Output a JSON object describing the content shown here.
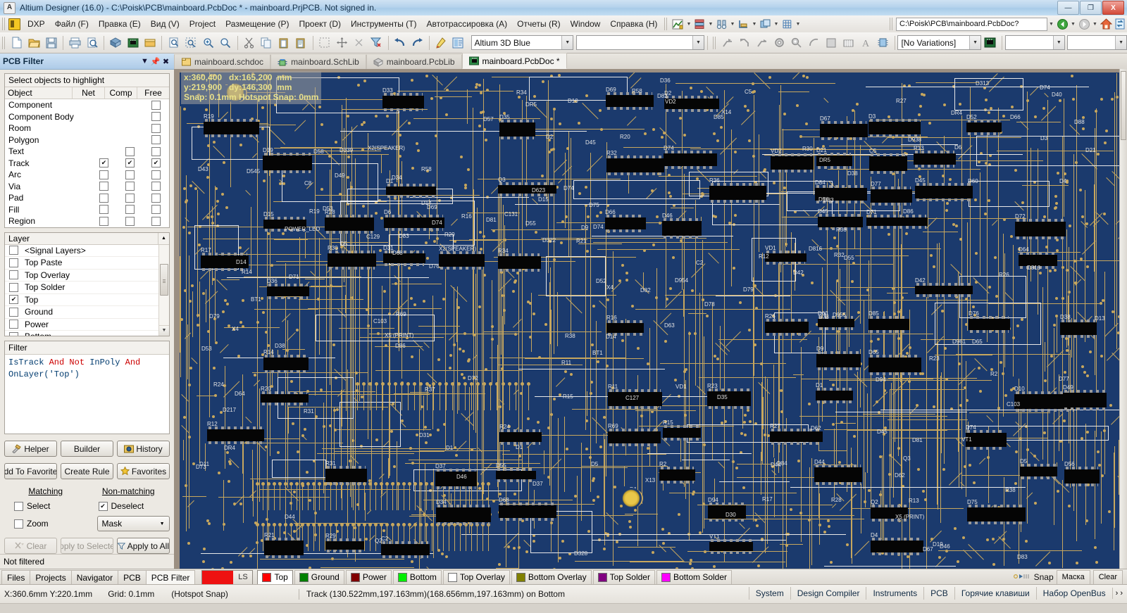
{
  "window": {
    "title": "Altium Designer (16.0) - C:\\Poisk\\PCB\\mainboard.PcbDoc * - mainboard.PrjPCB. Not signed in.",
    "app_icon": "A",
    "minimize": "—",
    "maximize": "❐",
    "close": "X"
  },
  "menu": {
    "items": [
      {
        "label": "DXP"
      },
      {
        "label": "Файл (F)"
      },
      {
        "label": "Правка (E)"
      },
      {
        "label": "Вид (V)"
      },
      {
        "label": "Project"
      },
      {
        "label": "Размещение (P)"
      },
      {
        "label": "Проект (D)"
      },
      {
        "label": "Инструменты (T)"
      },
      {
        "label": "Автотрассировка (A)"
      },
      {
        "label": "Отчеты (R)"
      },
      {
        "label": "Window"
      },
      {
        "label": "Справка (H)"
      }
    ],
    "path_value": "C:\\Poisk\\PCB\\mainboard.PcbDoc?"
  },
  "toolbar": {
    "view_config": "Altium 3D Blue",
    "variations": "[No Variations]",
    "empty_combo_1": "",
    "empty_combo_2": ""
  },
  "panel": {
    "title": "PCB Filter",
    "object_section_title": "Select objects to highlight",
    "columns": [
      "Object",
      "Net",
      "Comp",
      "Free"
    ],
    "objects": [
      {
        "name": "Component",
        "net": null,
        "comp": null,
        "free": false
      },
      {
        "name": "Component Body",
        "net": null,
        "comp": null,
        "free": false
      },
      {
        "name": "Room",
        "net": null,
        "comp": null,
        "free": false
      },
      {
        "name": "Polygon",
        "net": null,
        "comp": null,
        "free": false
      },
      {
        "name": "Text",
        "net": null,
        "comp": false,
        "free": false
      },
      {
        "name": "Track",
        "net": true,
        "comp": true,
        "free": true
      },
      {
        "name": "Arc",
        "net": false,
        "comp": false,
        "free": false
      },
      {
        "name": "Via",
        "net": false,
        "comp": false,
        "free": false
      },
      {
        "name": "Pad",
        "net": false,
        "comp": false,
        "free": false
      },
      {
        "name": "Fill",
        "net": false,
        "comp": false,
        "free": false
      },
      {
        "name": "Region",
        "net": false,
        "comp": false,
        "free": false
      }
    ],
    "layer_header": "Layer",
    "layers": [
      {
        "name": "<Signal Layers>",
        "checked": false
      },
      {
        "name": "Top Paste",
        "checked": false
      },
      {
        "name": "Top Overlay",
        "checked": false
      },
      {
        "name": "Top Solder",
        "checked": false
      },
      {
        "name": "Top",
        "checked": true
      },
      {
        "name": "Ground",
        "checked": false
      },
      {
        "name": "Power",
        "checked": false
      },
      {
        "name": "Bottom",
        "checked": false
      }
    ],
    "filter_header": "Filter",
    "filter_expression": {
      "parts": [
        {
          "t": "IsTrack ",
          "kw": false
        },
        {
          "t": "And Not ",
          "kw": true
        },
        {
          "t": "InPoly ",
          "kw": false
        },
        {
          "t": "And ",
          "kw": true
        },
        {
          "t": "OnLayer('Top')",
          "kw": false
        }
      ]
    },
    "buttons_row1": [
      {
        "label": "Helper",
        "icon": "hammer-icon",
        "disabled": false
      },
      {
        "label": "Builder",
        "icon": null,
        "disabled": false
      },
      {
        "label": "History",
        "icon": "history-icon",
        "disabled": false
      }
    ],
    "buttons_row2": [
      {
        "label": "dd To Favorite",
        "icon": null,
        "disabled": false
      },
      {
        "label": "Create Rule",
        "icon": null,
        "disabled": false
      },
      {
        "label": "Favorites",
        "icon": "star-icon",
        "disabled": false
      }
    ],
    "matching_label": "Matching",
    "nonmatching_label": "Non-matching",
    "select_label": "Select",
    "select_checked": false,
    "zoom_label": "Zoom",
    "zoom_checked": false,
    "deselect_label": "Deselect",
    "deselect_checked": true,
    "mask_value": "Mask",
    "buttons_row3": [
      {
        "label": "Clear",
        "icon": "clear-icon",
        "disabled": true
      },
      {
        "label": "pply to Selecte",
        "icon": null,
        "disabled": true
      },
      {
        "label": "Apply to All",
        "icon": "filter-icon",
        "disabled": false
      }
    ],
    "status": "Not filtered"
  },
  "document_tabs": [
    {
      "label": "mainboard.schdoc",
      "icon": "schematic-doc-icon",
      "active": false
    },
    {
      "label": "mainboard.SchLib",
      "icon": "sch-lib-icon",
      "active": false
    },
    {
      "label": "mainboard.PcbLib",
      "icon": "pcb-lib-icon",
      "active": false
    },
    {
      "label": "mainboard.PcbDoc *",
      "icon": "pcb-doc-icon",
      "active": true
    }
  ],
  "canvas": {
    "coord_overlay": "x:360,400   dx:165,200  mm\ny:219,900   dy:146,300  mm\nSnap: 0.1mm Hotspot Snap: 0mm",
    "board_color": "#1b3a6d",
    "trace_color": "#c7a75e",
    "silk_color": "#e8e8e8",
    "component_color": "#050505",
    "designators": [
      "R19",
      "R17",
      "R12",
      "D19",
      "D15",
      "D36",
      "R14",
      "R20",
      "R21",
      "R28",
      "R30",
      "R31",
      "R29",
      "D33",
      "D1",
      "D6",
      "D31",
      "C2",
      "X2(SPEAKER)",
      "D37",
      "D34",
      "D35",
      "Q3",
      "R34",
      "R24",
      "D55",
      "D68",
      "D69",
      "R32",
      "D66",
      "R16",
      "R11",
      "R69",
      "D2",
      "D74",
      "D46",
      "R15",
      "R2",
      "R36",
      "R23",
      "D94",
      "VT1",
      "VD2",
      "VD1",
      "R26",
      "R27",
      "D67",
      "D21",
      "D84",
      "D45",
      "D63",
      "D9",
      "D1",
      "D44",
      "D3",
      "C5",
      "D77",
      "D71",
      "D85",
      "D65",
      "Q2",
      "D4",
      "R13",
      "D45",
      "D42",
      "D52",
      "D76",
      "D74",
      "D75",
      "D72",
      "D64",
      "D10",
      "D5",
      "D38",
      "D49",
      "D56",
      "D73",
      "D81",
      "D83",
      "DR5",
      "D79",
      "DR4",
      "D74",
      "X4",
      "C103",
      "R58",
      "D14",
      "D62",
      "D53",
      "D82",
      "D86",
      "D816",
      "R38",
      "X5 (PRINT)",
      "BT1",
      "D40",
      "D88",
      "D60",
      "D55",
      "D5",
      "D78",
      "D58",
      "C129",
      "C127",
      "C8",
      "D955",
      "D339",
      "D623",
      "D328",
      "D217",
      "POWER_LED",
      "C131",
      "X14",
      "D46",
      "D30",
      "D38",
      "D14",
      "X13",
      "D1",
      "D57",
      "D43",
      "D954",
      "D938",
      "D322",
      "D313",
      "D11",
      "D44",
      "D961",
      "D545",
      "D13",
      "R37"
    ]
  },
  "layer_bar": {
    "panel_tabs": [
      {
        "label": "Files",
        "selected": false
      },
      {
        "label": "Projects",
        "selected": false
      },
      {
        "label": "Navigator",
        "selected": false
      },
      {
        "label": "PCB",
        "selected": false
      },
      {
        "label": "PCB Filter",
        "selected": true
      }
    ],
    "ls_label": "LS",
    "ls_color": "#ee1111",
    "layers": [
      {
        "label": "Top",
        "color": "#ff0000",
        "active": true
      },
      {
        "label": "Ground",
        "color": "#008000",
        "active": false
      },
      {
        "label": "Power",
        "color": "#800000",
        "active": false
      },
      {
        "label": "Bottom",
        "color": "#00ee00",
        "active": false
      },
      {
        "label": "Top Overlay",
        "color": "#ffffff",
        "active": false
      },
      {
        "label": "Bottom Overlay",
        "color": "#808000",
        "active": false
      },
      {
        "label": "Top Solder",
        "color": "#800080",
        "active": false
      },
      {
        "label": "Bottom Solder",
        "color": "#ff00ff",
        "active": false
      }
    ],
    "snap_label": "Snap",
    "mask_label": "Маска",
    "clear_label": "Clear"
  },
  "status_bar": {
    "coords": "X:360.6mm Y:220.1mm",
    "grid": "Grid: 0.1mm",
    "snap_mode": "(Hotspot Snap)",
    "object_info": "Track (130.522mm,197.163mm)(168.656mm,197.163mm) on Bottom",
    "tabs": [
      {
        "label": "System"
      },
      {
        "label": "Design Compiler"
      },
      {
        "label": "Instruments"
      },
      {
        "label": "PCB"
      },
      {
        "label": "Горячие клавиши"
      },
      {
        "label": "Набор OpenBus"
      }
    ],
    "more": "› ›"
  }
}
